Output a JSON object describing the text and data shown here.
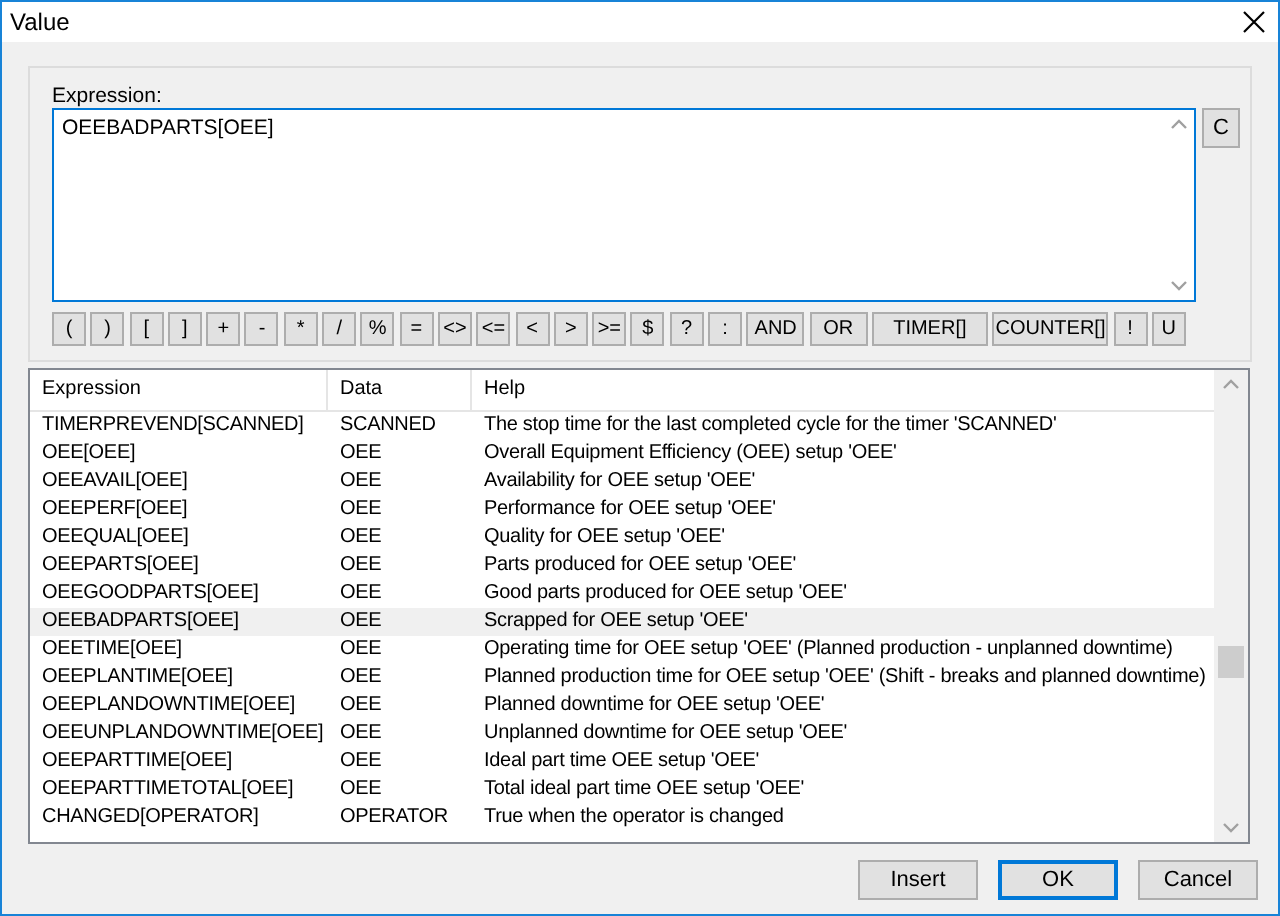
{
  "window": {
    "title": "Value"
  },
  "expression": {
    "label": "Expression:",
    "value": "OEEBADPARTS[OEE]",
    "clear_button": "C"
  },
  "operators": [
    {
      "label": "(",
      "kind": "symbol"
    },
    {
      "label": ")",
      "kind": "symbol"
    },
    {
      "label": "[",
      "kind": "symbol"
    },
    {
      "label": "]",
      "kind": "symbol"
    },
    {
      "label": "+",
      "kind": "symbol"
    },
    {
      "label": "-",
      "kind": "symbol"
    },
    {
      "label": "*",
      "kind": "symbol"
    },
    {
      "label": "/",
      "kind": "symbol"
    },
    {
      "label": "%",
      "kind": "symbol"
    },
    {
      "label": "=",
      "kind": "symbol"
    },
    {
      "label": "<>",
      "kind": "symbol"
    },
    {
      "label": "<=",
      "kind": "symbol"
    },
    {
      "label": "<",
      "kind": "symbol"
    },
    {
      "label": ">",
      "kind": "symbol"
    },
    {
      "label": ">=",
      "kind": "symbol"
    },
    {
      "label": "$",
      "kind": "symbol"
    },
    {
      "label": "?",
      "kind": "symbol"
    },
    {
      "label": ":",
      "kind": "symbol"
    },
    {
      "label": "AND",
      "kind": "keyword"
    },
    {
      "label": "OR",
      "kind": "keyword"
    },
    {
      "label": "TIMER[]",
      "kind": "function"
    },
    {
      "label": "COUNTER[]",
      "kind": "function"
    },
    {
      "label": "!",
      "kind": "symbol"
    },
    {
      "label": "U",
      "kind": "symbol"
    }
  ],
  "table": {
    "columns": [
      "Expression",
      "Data",
      "Help"
    ],
    "rows": [
      {
        "expression": "TIMERPREVEND[SCANNED]",
        "data": "SCANNED",
        "help": "The stop time for the last completed cycle for the timer 'SCANNED'",
        "selected": false
      },
      {
        "expression": "OEE[OEE]",
        "data": "OEE",
        "help": "Overall Equipment Efficiency (OEE) setup 'OEE'",
        "selected": false
      },
      {
        "expression": "OEEAVAIL[OEE]",
        "data": "OEE",
        "help": "Availability for OEE setup 'OEE'",
        "selected": false
      },
      {
        "expression": "OEEPERF[OEE]",
        "data": "OEE",
        "help": "Performance for OEE setup 'OEE'",
        "selected": false
      },
      {
        "expression": "OEEQUAL[OEE]",
        "data": "OEE",
        "help": "Quality for OEE setup 'OEE'",
        "selected": false
      },
      {
        "expression": "OEEPARTS[OEE]",
        "data": "OEE",
        "help": "Parts produced for OEE setup 'OEE'",
        "selected": false
      },
      {
        "expression": "OEEGOODPARTS[OEE]",
        "data": "OEE",
        "help": "Good parts produced for OEE setup 'OEE'",
        "selected": false
      },
      {
        "expression": "OEEBADPARTS[OEE]",
        "data": "OEE",
        "help": "Scrapped for OEE setup 'OEE'",
        "selected": true
      },
      {
        "expression": "OEETIME[OEE]",
        "data": "OEE",
        "help": "Operating time for OEE setup 'OEE' (Planned production - unplanned downtime)",
        "selected": false
      },
      {
        "expression": "OEEPLANTIME[OEE]",
        "data": "OEE",
        "help": "Planned production time for OEE setup 'OEE' (Shift - breaks and planned downtime)",
        "selected": false
      },
      {
        "expression": "OEEPLANDOWNTIME[OEE]",
        "data": "OEE",
        "help": "Planned downtime for OEE setup 'OEE'",
        "selected": false
      },
      {
        "expression": "OEEUNPLANDOWNTIME[OEE]",
        "data": "OEE",
        "help": "Unplanned downtime for OEE setup 'OEE'",
        "selected": false
      },
      {
        "expression": "OEEPARTTIME[OEE]",
        "data": "OEE",
        "help": "Ideal part time OEE setup 'OEE'",
        "selected": false
      },
      {
        "expression": "OEEPARTTIMETOTAL[OEE]",
        "data": "OEE",
        "help": "Total ideal part time OEE setup 'OEE'",
        "selected": false
      },
      {
        "expression": "CHANGED[OPERATOR]",
        "data": "OPERATOR",
        "help": "True when the operator is changed",
        "selected": false
      }
    ]
  },
  "buttons": [
    {
      "label": "Insert",
      "default": false
    },
    {
      "label": "OK",
      "default": true
    },
    {
      "label": "Cancel",
      "default": false
    }
  ]
}
